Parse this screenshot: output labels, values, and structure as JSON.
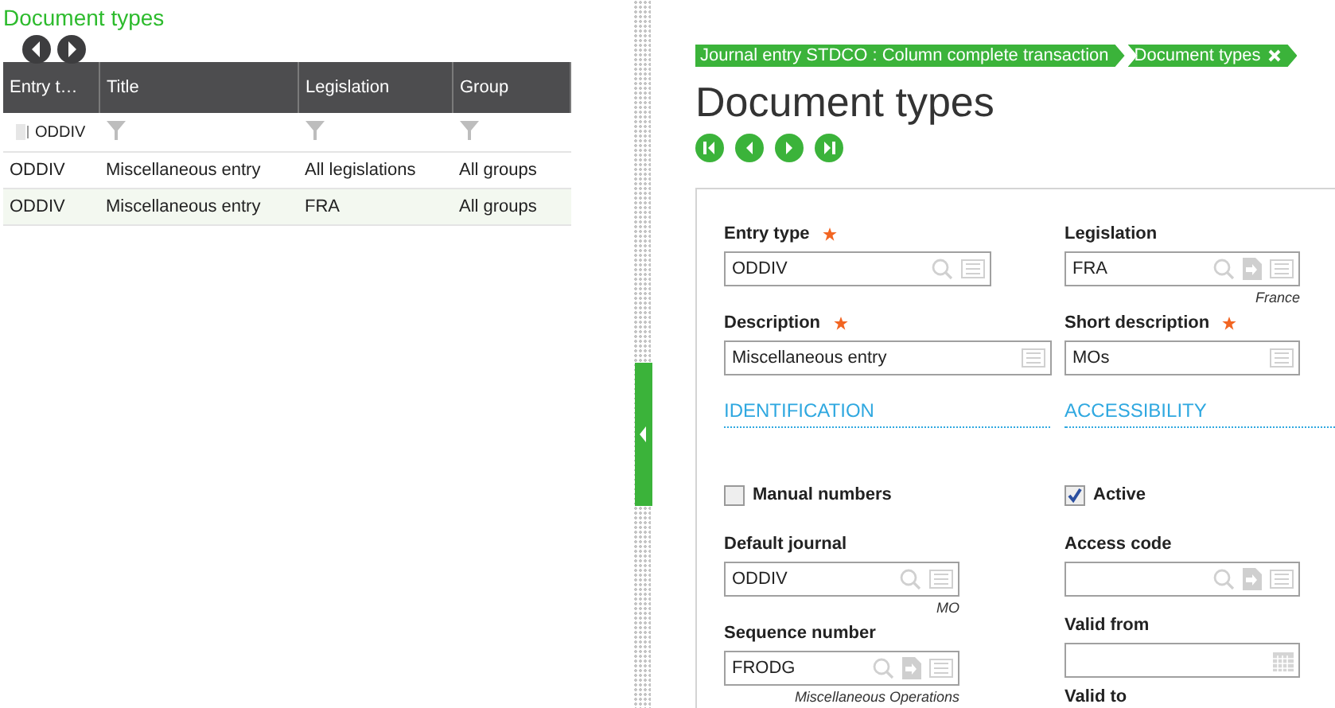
{
  "left_panel": {
    "title": "Document types",
    "table": {
      "columns": [
        "Entry t…",
        "Title",
        "Legislation",
        "Group"
      ],
      "filter": {
        "value": "ODDIV"
      },
      "rows": [
        {
          "cells": [
            "ODDIV",
            "Miscellaneous entry",
            "All legislations",
            "All groups"
          ],
          "selected": false
        },
        {
          "cells": [
            "ODDIV",
            "Miscellaneous entry",
            "FRA",
            "All groups"
          ],
          "selected": true
        }
      ]
    }
  },
  "breadcrumb": [
    {
      "label": "Journal entry STDCO : Column complete transaction",
      "closable": false
    },
    {
      "label": "Document types",
      "closable": true
    }
  ],
  "page_title": "Document types",
  "record_nav": [
    {
      "kind": "first"
    },
    {
      "kind": "prev"
    },
    {
      "kind": "next"
    },
    {
      "kind": "last"
    }
  ],
  "form": {
    "columns": [
      [
        {
          "kind": "field",
          "label": "Entry type",
          "required": true,
          "value": "ODDIV",
          "icons": [
            {
              "kind": "search"
            },
            {
              "kind": "detail"
            }
          ]
        },
        {
          "kind": "field",
          "label": "Description",
          "required": true,
          "value": "Miscellaneous entry",
          "icons": [
            {
              "kind": "detail"
            }
          ]
        },
        {
          "kind": "section",
          "label": "IDENTIFICATION"
        },
        {
          "kind": "checkbox",
          "label": "Manual numbers",
          "checked": false
        },
        {
          "kind": "field",
          "label": "Default journal",
          "required": false,
          "value": "ODDIV",
          "icons": [
            {
              "kind": "search"
            },
            {
              "kind": "detail"
            }
          ],
          "caption": "MO"
        },
        {
          "kind": "field",
          "label": "Sequence number",
          "required": false,
          "value": "FRODG",
          "icons": [
            {
              "kind": "search"
            },
            {
              "kind": "link"
            },
            {
              "kind": "detail"
            }
          ],
          "caption": "Miscellaneous Operations"
        }
      ],
      [
        {
          "kind": "field",
          "label": "Legislation",
          "required": false,
          "value": "FRA",
          "icons": [
            {
              "kind": "search"
            },
            {
              "kind": "link"
            },
            {
              "kind": "detail"
            }
          ],
          "caption": "France"
        },
        {
          "kind": "field",
          "label": "Short description",
          "required": true,
          "value": "MOs",
          "icons": [
            {
              "kind": "detail"
            }
          ]
        },
        {
          "kind": "section",
          "label": "ACCESSIBILITY"
        },
        {
          "kind": "checkbox",
          "label": "Active",
          "checked": true
        },
        {
          "kind": "field",
          "label": "Access code",
          "required": false,
          "icons": [
            {
              "kind": "search"
            },
            {
              "kind": "link"
            },
            {
              "kind": "detail"
            }
          ]
        },
        {
          "kind": "field",
          "label": "Valid from",
          "required": false,
          "icons": [
            {
              "kind": "calendar"
            }
          ]
        },
        {
          "kind": "label",
          "label": "Valid to"
        }
      ]
    ]
  }
}
